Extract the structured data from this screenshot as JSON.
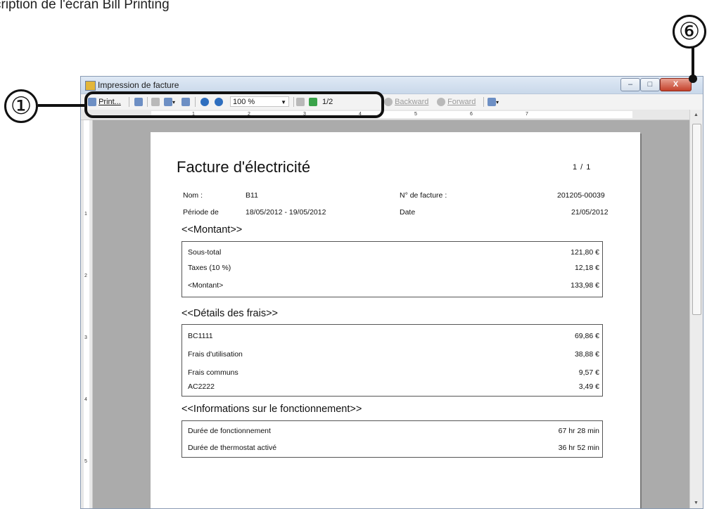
{
  "page_heading": "cription de l'écran Bill Printing",
  "callouts": {
    "one": "①",
    "six": "⑥"
  },
  "window": {
    "title": "Impression de facture",
    "controls": {
      "minimize": "–",
      "maximize": "□",
      "close": "X"
    }
  },
  "toolbar": {
    "print_label": "Print...",
    "zoom_value": "100 %",
    "page_indicator": "1/2",
    "backward_label": "Backward",
    "forward_label": "Forward"
  },
  "ruler": {
    "numbers": [
      "1",
      "2",
      "3",
      "4",
      "5",
      "6",
      "7"
    ]
  },
  "document": {
    "title": "Facture d'électricité",
    "page_count": "1 /   1",
    "fields": {
      "name_label": "Nom :",
      "name_value": "B11",
      "invoice_label": "N° de facture :",
      "invoice_value": "201205-00039",
      "period_label": "Période de",
      "period_value": "18/05/2012 - 19/05/2012",
      "date_label": "Date",
      "date_value": "21/05/2012"
    },
    "amount_section": {
      "heading": "<<Montant>>",
      "rows": [
        {
          "label": "Sous-total",
          "value": "121,80 €"
        },
        {
          "label": "Taxes (10 %)",
          "value": "12,18 €"
        },
        {
          "label": "<Montant>",
          "value": "133,98 €"
        }
      ]
    },
    "charges_section": {
      "heading": "<<Détails des frais>>",
      "rows": [
        {
          "label": "BC1111",
          "value": "69,86 €"
        },
        {
          "label": "Frais d'utilisation",
          "value": "38,88 €"
        },
        {
          "label": "Frais communs",
          "value": "9,57 €"
        },
        {
          "label": "AC2222",
          "value": "3,49 €"
        }
      ]
    },
    "operation_section": {
      "heading": "<<Informations sur le fonctionnement>>",
      "rows": [
        {
          "label": "Durée de fonctionnement",
          "value": "67 hr 28 min"
        },
        {
          "label": "Durée de thermostat activé",
          "value": "36 hr 52 min"
        }
      ]
    }
  }
}
